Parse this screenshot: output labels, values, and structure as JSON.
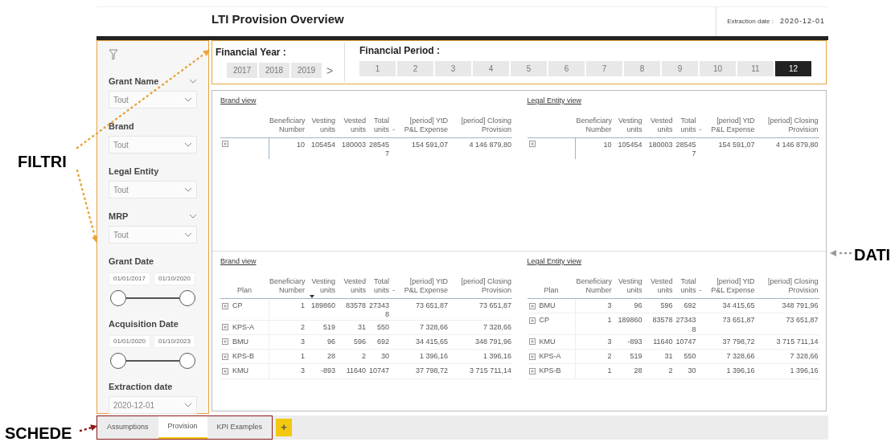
{
  "annotations": [
    {
      "kind": "filters",
      "text": "FILTRI"
    },
    {
      "kind": "data",
      "text": "DATI"
    },
    {
      "kind": "tabs",
      "text": "SCHEDE"
    }
  ],
  "header": {
    "title": "LTI Provision Overview",
    "extraction_label": "Extraction date :",
    "extraction_value": "2020-12-01"
  },
  "filters": [
    {
      "kind": "dropdown",
      "label": "Grant Name",
      "value": "Tout",
      "expandable": true
    },
    {
      "kind": "dropdown",
      "label": "Brand",
      "value": "Tout",
      "expandable": false
    },
    {
      "kind": "dropdown",
      "label": "Legal Entity",
      "value": "Tout",
      "expandable": false
    },
    {
      "kind": "dropdown",
      "label": "MRP",
      "value": "Tout",
      "expandable": true
    },
    {
      "kind": "date_range",
      "label": "Grant Date",
      "start": "01/01/2017",
      "end": "01/10/2020",
      "level": 1
    },
    {
      "kind": "date_range",
      "label": "Acquisition Date",
      "start": "01/01/2020",
      "end": "01/10/2023",
      "level": 1
    },
    {
      "kind": "dropdown",
      "label": "Extraction date",
      "value": "2020-12-01",
      "expandable": false
    }
  ],
  "financial_year": {
    "title": "Financial Year :",
    "next": ">",
    "items": [
      {
        "label": "2017",
        "selected": false
      },
      {
        "label": "2018",
        "selected": false
      },
      {
        "label": "2019",
        "selected": false
      }
    ]
  },
  "financial_period": {
    "title": "Financial Period :",
    "items": [
      {
        "label": "1",
        "selected": false
      },
      {
        "label": "2",
        "selected": false
      },
      {
        "label": "3",
        "selected": false
      },
      {
        "label": "4",
        "selected": false
      },
      {
        "label": "5",
        "selected": false
      },
      {
        "label": "6",
        "selected": false
      },
      {
        "label": "7",
        "selected": false
      },
      {
        "label": "8",
        "selected": false
      },
      {
        "label": "9",
        "selected": false
      },
      {
        "label": "10",
        "selected": false
      },
      {
        "label": "11",
        "selected": false
      },
      {
        "label": "12",
        "selected": true
      }
    ]
  },
  "tables": [
    {
      "title": "Brand view",
      "columns": [
        {
          "label": "Beneficiary Number",
          "kind": "value",
          "sorted": false
        },
        {
          "label": "Vesting units",
          "kind": "value",
          "sorted": false
        },
        {
          "label": "Vested units",
          "kind": "value",
          "sorted": false
        },
        {
          "label": "Total units",
          "kind": "value",
          "sorted": false
        },
        {
          "label": "-",
          "kind": "spacer",
          "sorted": false
        },
        {
          "label": "[period] YtD P&L Expense",
          "kind": "value",
          "sorted": false
        },
        {
          "label": "[period] Closing Provision",
          "kind": "value",
          "sorted": false
        }
      ],
      "rows": [
        {
          "expanded": false,
          "values": [
            "10",
            "105454",
            "180003",
            "285457",
            "154 591,07",
            "4 146 879,80"
          ]
        }
      ]
    },
    {
      "title": "Legal Entity view",
      "columns": [
        {
          "label": "Beneficiary Number",
          "kind": "value",
          "sorted": false
        },
        {
          "label": "Vesting units",
          "kind": "value",
          "sorted": false
        },
        {
          "label": "Vested units",
          "kind": "value",
          "sorted": false
        },
        {
          "label": "Total units",
          "kind": "value",
          "sorted": false
        },
        {
          "label": "-",
          "kind": "spacer",
          "sorted": false
        },
        {
          "label": "[period] YtD P&L Expense",
          "kind": "value",
          "sorted": false
        },
        {
          "label": "[period] Closing Provision",
          "kind": "value",
          "sorted": false
        }
      ],
      "rows": [
        {
          "expanded": false,
          "values": [
            "10",
            "105454",
            "180003",
            "285457",
            "154 591,07",
            "4 146 879,80"
          ]
        }
      ]
    },
    {
      "title": "Brand view",
      "plan_header": "Plan",
      "columns": [
        {
          "label": "Beneficiary Number",
          "kind": "value",
          "sorted": false
        },
        {
          "label": "Vesting units",
          "kind": "value",
          "sorted": true
        },
        {
          "label": "Vested units",
          "kind": "value",
          "sorted": false
        },
        {
          "label": "Total units",
          "kind": "value",
          "sorted": false
        },
        {
          "label": "-",
          "kind": "spacer",
          "sorted": false
        },
        {
          "label": "[period] YtD P&L Expense",
          "kind": "value",
          "sorted": false
        },
        {
          "label": "[period] Closing Provision",
          "kind": "value",
          "sorted": false
        }
      ],
      "rows": [
        {
          "plan": "CP",
          "expanded": false,
          "values": [
            "1",
            "189860",
            "83578",
            "273438",
            "73 651,87",
            "73 651,87"
          ]
        },
        {
          "plan": "KPS-A",
          "expanded": false,
          "values": [
            "2",
            "519",
            "31",
            "550",
            "7 328,66",
            "7 328,66"
          ]
        },
        {
          "plan": "BMU",
          "expanded": false,
          "values": [
            "3",
            "96",
            "596",
            "692",
            "34 415,65",
            "348 791,96"
          ]
        },
        {
          "plan": "KPS-B",
          "expanded": false,
          "values": [
            "1",
            "28",
            "2",
            "30",
            "1 396,16",
            "1 396,16"
          ]
        },
        {
          "plan": "KMU",
          "expanded": false,
          "values": [
            "3",
            "-893",
            "11640",
            "10747",
            "37 798,72",
            "3 715 711,14"
          ]
        }
      ]
    },
    {
      "title": "Legal Entity view",
      "plan_header": "Plan",
      "columns": [
        {
          "label": "Beneficiary Number",
          "kind": "value",
          "sorted": false
        },
        {
          "label": "Vesting units",
          "kind": "value",
          "sorted": false
        },
        {
          "label": "Vested units",
          "kind": "value",
          "sorted": false
        },
        {
          "label": "Total units",
          "kind": "value",
          "sorted": false
        },
        {
          "label": "-",
          "kind": "spacer",
          "sorted": false
        },
        {
          "label": "[period] YtD P&L Expense",
          "kind": "value",
          "sorted": false
        },
        {
          "label": "[period] Closing Provision",
          "kind": "value",
          "sorted": false
        }
      ],
      "rows": [
        {
          "plan": "BMU",
          "expanded": false,
          "values": [
            "3",
            "96",
            "596",
            "692",
            "34 415,65",
            "348 791,96"
          ]
        },
        {
          "plan": "CP",
          "expanded": false,
          "values": [
            "1",
            "189860",
            "83578",
            "273438",
            "73 651,87",
            "73 651,87"
          ]
        },
        {
          "plan": "KMU",
          "expanded": false,
          "values": [
            "3",
            "-893",
            "11640",
            "10747",
            "37 798,72",
            "3 715 711,14"
          ]
        },
        {
          "plan": "KPS-A",
          "expanded": false,
          "values": [
            "2",
            "519",
            "31",
            "550",
            "7 328,66",
            "7 328,66"
          ]
        },
        {
          "plan": "KPS-B",
          "expanded": false,
          "values": [
            "1",
            "28",
            "2",
            "30",
            "1 396,16",
            "1 396,16"
          ]
        }
      ]
    }
  ],
  "tabs": [
    {
      "label": "Assumptions",
      "selected": false
    },
    {
      "label": "Provision",
      "selected": true
    },
    {
      "label": "KPI Examples",
      "selected": false
    }
  ],
  "add_tab": "+"
}
